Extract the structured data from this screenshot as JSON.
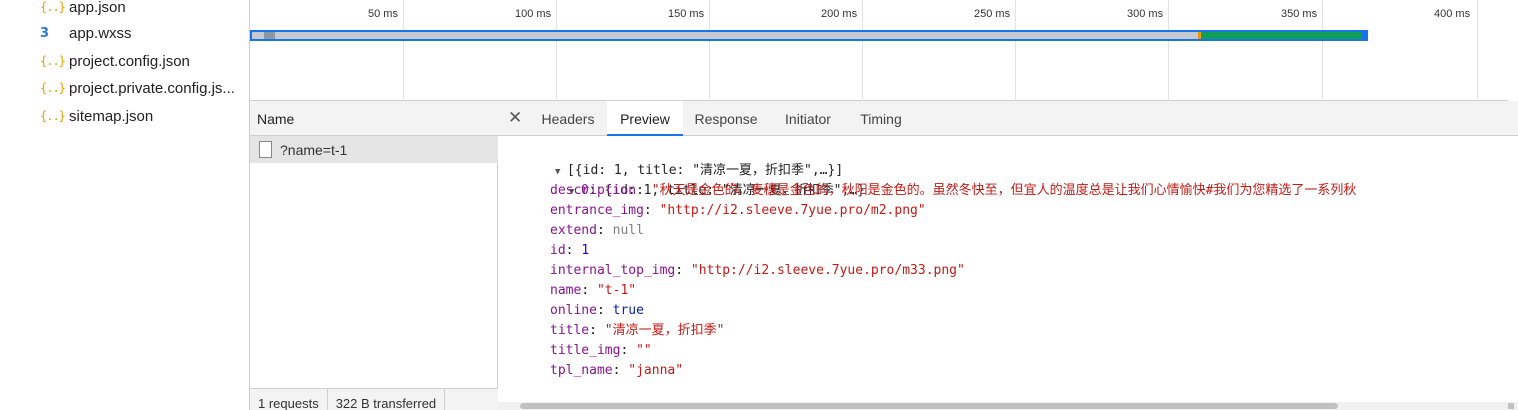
{
  "file_tree": {
    "items": [
      {
        "icon": "json-file-icon",
        "glyph": "{..}",
        "label": "app.json"
      },
      {
        "icon": "css-file-icon",
        "glyph": "3",
        "label": "app.wxss"
      },
      {
        "icon": "json-file-icon",
        "glyph": "{..}",
        "label": "project.config.json"
      },
      {
        "icon": "json-file-icon",
        "glyph": "{..}",
        "label": "project.private.config.js..."
      },
      {
        "icon": "json-file-icon",
        "glyph": "{..}",
        "label": "sitemap.json"
      }
    ]
  },
  "overview": {
    "ticks": [
      "50 ms",
      "100 ms",
      "150 ms",
      "200 ms",
      "250 ms",
      "300 ms",
      "350 ms",
      "400 ms"
    ],
    "bar_colors": {
      "border": "#1a73e8",
      "waiting": "#c5c9cf",
      "queue": "#8a97a4",
      "ttfb": "#f29900",
      "download": "#0f9d58"
    }
  },
  "request_list": {
    "header": "Name",
    "requests": [
      {
        "name": "?name=t-1"
      }
    ],
    "status": {
      "requests": "1 requests",
      "transferred": "322 B transferred"
    }
  },
  "details": {
    "close_glyph": "✕",
    "tabs": [
      {
        "label": "Headers",
        "active": false
      },
      {
        "label": "Preview",
        "active": true
      },
      {
        "label": "Response",
        "active": false
      },
      {
        "label": "Initiator",
        "active": false
      },
      {
        "label": "Timing",
        "active": false
      }
    ],
    "preview": {
      "root_summary": "[{id: 1, title: \"清凉一夏，折扣季\",…}]",
      "item_summary_key": "0",
      "item_summary": "{id: 1, title: \"清凉一夏，折扣季\",…}",
      "fields": [
        {
          "key": "description",
          "value": "\"秋天是金色的。麦穗是金色的，秋阳是金色的。虽然冬快至，但宜人的温度总是让我们心情愉快#我们为您精选了一系列秋",
          "type": "str"
        },
        {
          "key": "entrance_img",
          "value": "\"http://i2.sleeve.7yue.pro/m2.png\"",
          "type": "str"
        },
        {
          "key": "extend",
          "value": "null",
          "type": "nul"
        },
        {
          "key": "id",
          "value": "1",
          "type": "num"
        },
        {
          "key": "internal_top_img",
          "value": "\"http://i2.sleeve.7yue.pro/m33.png\"",
          "type": "str"
        },
        {
          "key": "name",
          "value": "\"t-1\"",
          "type": "str"
        },
        {
          "key": "online",
          "value": "true",
          "type": "bool"
        },
        {
          "key": "title",
          "value": "\"清凉一夏，折扣季\"",
          "type": "str"
        },
        {
          "key": "title_img",
          "value": "\"\"",
          "type": "str"
        },
        {
          "key": "tpl_name",
          "value": "\"janna\"",
          "type": "str"
        }
      ]
    }
  }
}
